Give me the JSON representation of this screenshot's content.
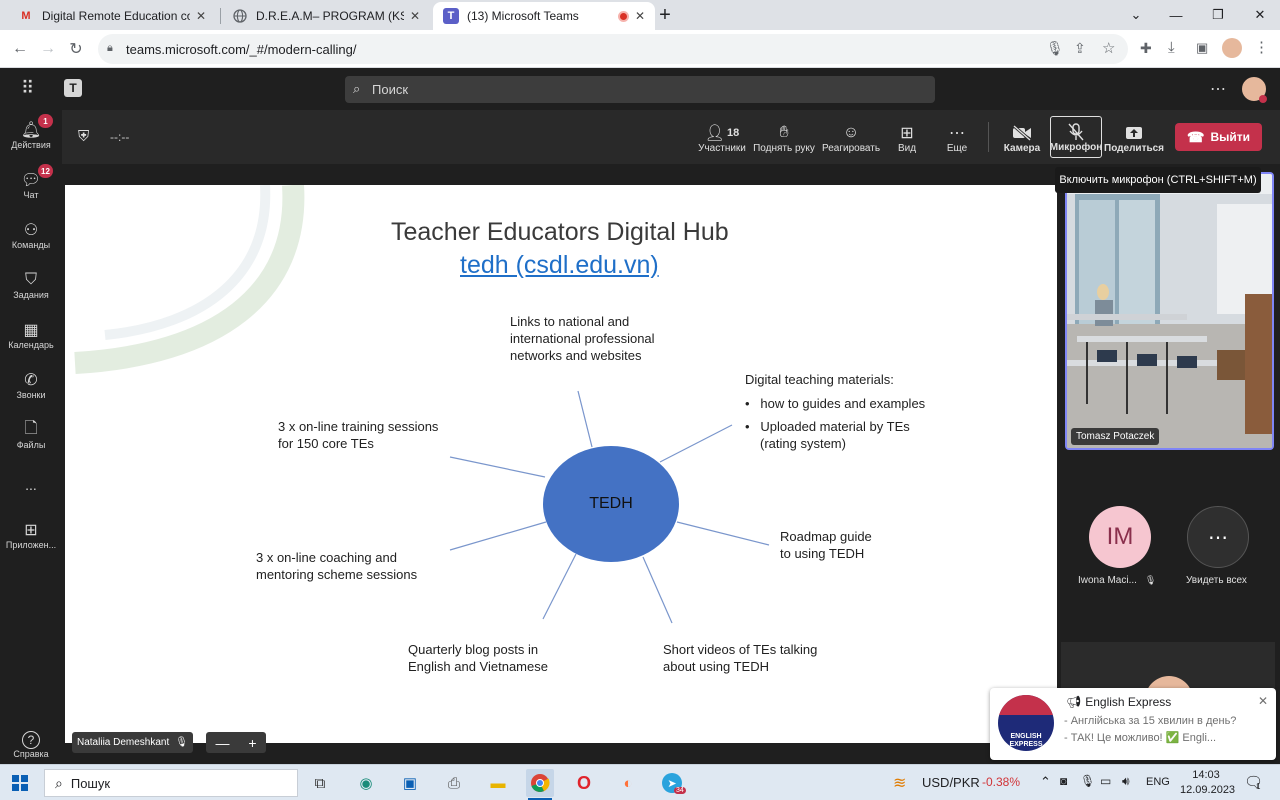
{
  "browser": {
    "tabs": [
      {
        "title": "Digital Remote Education confer",
        "favicon": "gmail-icon"
      },
      {
        "title": "D.R.E.A.M– PROGRAM (KSIĄŻECZ",
        "favicon": "globe-icon"
      },
      {
        "title": "(13) Microsoft Teams",
        "favicon": "teams-icon"
      }
    ],
    "new_tab_label": "+",
    "url": "teams.microsoft.com/_#/modern-calling/"
  },
  "teams": {
    "search_placeholder": "Поиск",
    "rail": [
      {
        "label": "Действия",
        "badge": "1"
      },
      {
        "label": "Чат",
        "badge": "12"
      },
      {
        "label": "Команды",
        "badge": ""
      },
      {
        "label": "Задания",
        "badge": ""
      },
      {
        "label": "Календарь",
        "badge": ""
      },
      {
        "label": "Звонки",
        "badge": ""
      },
      {
        "label": "Файлы",
        "badge": ""
      },
      {
        "label": "...",
        "badge": ""
      },
      {
        "label": "Приложен...",
        "badge": ""
      }
    ],
    "help_label": "Справка"
  },
  "meeting": {
    "timer": "--:--",
    "participants_count": "18",
    "controls": {
      "participants": "Участники",
      "raise_hand": "Поднять руку",
      "react": "Реагировать",
      "view": "Вид",
      "more": "Еще",
      "camera": "Камера",
      "mic": "Микрофон",
      "share": "Поделиться",
      "leave": "Выйти"
    },
    "tooltip": "Включить микрофон (CTRL+SHIFT+M)",
    "presenter_name": "Nataliia Demeshkant",
    "zoom_minus": "—",
    "zoom_plus": "+"
  },
  "slide": {
    "title": "Teacher Educators Digital Hub",
    "link": "tedh (csdl.edu.vn)",
    "center": "TEDH",
    "nodes": {
      "links": [
        "Links to national and",
        "international professional",
        "networks and websites"
      ],
      "digital_heading": "Digital teaching materials:",
      "digital_b1": "how to guides and examples",
      "digital_b2": [
        "Uploaded material by TEs",
        "(rating system)"
      ],
      "training": [
        "3 x on-line training sessions",
        "for 150 core TEs"
      ],
      "roadmap": [
        "Roadmap guide",
        "to using TEDH"
      ],
      "coaching": [
        "3 x on-line coaching and",
        "mentoring scheme sessions"
      ],
      "blog": [
        "Quarterly blog posts in",
        "English and Vietnamese"
      ],
      "videos": [
        "Short videos of TEs talking",
        "about using TEDH"
      ]
    }
  },
  "participants": {
    "video_name": "Tomasz Potaczek",
    "im_initials": "IM",
    "im_name": "Iwona Maci...",
    "see_all": "Увидеть всех"
  },
  "notification": {
    "title": "English Express",
    "line1": "- Англійська за 15 хвилин в день?",
    "line2": "- ТАК! Це можливо! ✅  Engli...",
    "logo_text": "ENGLISH EXPRESS"
  },
  "taskbar": {
    "search": "Пошук",
    "ticker_pair": "USD/PKR",
    "ticker_change": "-0.38%",
    "lang": "ENG",
    "time": "14:03",
    "date": "12.09.2023",
    "telegram_badge": "34",
    "notif_count": "1"
  },
  "colors": {
    "teams_dark": "#1f1f1f",
    "leave_red": "#c4314b",
    "accent_purple": "#7f85f5",
    "ellipse_blue": "#4472c4",
    "link_blue": "#1f6fc8",
    "ticker_red": "#d13438"
  }
}
